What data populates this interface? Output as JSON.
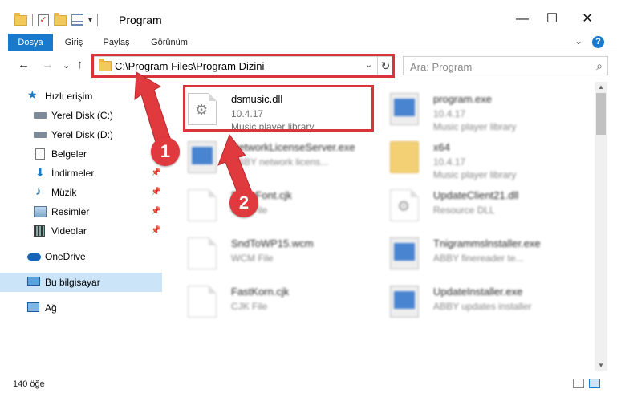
{
  "window": {
    "title": "Program",
    "minimize_icon": "—",
    "maximize_icon": "☐",
    "close_icon": "✕"
  },
  "ribbon": {
    "tabs": [
      {
        "label": "Dosya",
        "active": true
      },
      {
        "label": "Giriş",
        "active": false
      },
      {
        "label": "Paylaş",
        "active": false
      },
      {
        "label": "Görünüm",
        "active": false
      }
    ],
    "expand_icon": "⌄",
    "help_icon": "?"
  },
  "address": {
    "back_icon": "←",
    "forward_icon": "→",
    "recent_icon": "⌄",
    "up_icon": "↑",
    "path": "C:\\Program Files\\Program Dizini",
    "dropdown_icon": "⌄",
    "refresh_icon": "↻"
  },
  "search": {
    "placeholder": "Ara: Program",
    "icon": "⌕"
  },
  "sidebar": {
    "items": [
      {
        "label": "Hızlı erişim",
        "icon": "star-icon"
      },
      {
        "label": "Yerel Disk (C:)",
        "icon": "drive-icon"
      },
      {
        "label": "Yerel Disk (D:)",
        "icon": "drive-icon"
      },
      {
        "label": "Belgeler",
        "icon": "documents-icon",
        "pinned": true
      },
      {
        "label": "İndirmeler",
        "icon": "download-icon",
        "pinned": true
      },
      {
        "label": "Müzik",
        "icon": "music-icon",
        "pinned": true
      },
      {
        "label": "Resimler",
        "icon": "pictures-icon",
        "pinned": true
      },
      {
        "label": "Videolar",
        "icon": "videos-icon",
        "pinned": true
      },
      {
        "label": "OneDrive",
        "icon": "cloud-icon"
      },
      {
        "label": "Bu bilgisayar",
        "icon": "computer-icon",
        "selected": true
      },
      {
        "label": "Ağ",
        "icon": "network-icon"
      }
    ],
    "pin_glyph": "📌"
  },
  "files": [
    {
      "name": "dsmusic.dll",
      "line2": "10.4.17",
      "line3": "Music player library",
      "icon": "dll-gear-icon",
      "highlighted": true
    },
    {
      "name": "program.exe",
      "line2": "10.4.17",
      "line3": "Music player library",
      "icon": "exe-icon",
      "blurred": true
    },
    {
      "name": "NetworkLicenseServer.exe",
      "line2": "ABBY network licens...",
      "line3": "",
      "icon": "exe-icon",
      "blurred": true
    },
    {
      "name": "x64",
      "line2": "10.4.17",
      "line3": "Music player library",
      "icon": "folder-icon",
      "blurred": true
    },
    {
      "name": "DrawFont.cjk",
      "line2": "CJK File",
      "line3": "",
      "icon": "document-icon",
      "blurred": true
    },
    {
      "name": "UpdateClient21.dll",
      "line2": "Resource DLL",
      "line3": "",
      "icon": "dll-gear-icon",
      "blurred": true
    },
    {
      "name": "SndToWP15.wcm",
      "line2": "WCM File",
      "line3": "",
      "icon": "document-icon",
      "blurred": true
    },
    {
      "name": "Tnigrammslnstaller.exe",
      "line2": "ABBY finereader te...",
      "line3": "",
      "icon": "exe-icon",
      "blurred": true
    },
    {
      "name": "FastKorn.cjk",
      "line2": "CJK File",
      "line3": "",
      "icon": "document-icon",
      "blurred": true
    },
    {
      "name": "UpdateInstaller.exe",
      "line2": "ABBY updates installer",
      "line3": "",
      "icon": "exe-icon",
      "blurred": true
    }
  ],
  "annotations": {
    "badge1": "1",
    "badge2": "2",
    "color": "#d9333b"
  },
  "status": {
    "item_count": "140 öğe"
  },
  "colors": {
    "accent": "#1979ca",
    "selected_bg": "#cce4f7"
  }
}
